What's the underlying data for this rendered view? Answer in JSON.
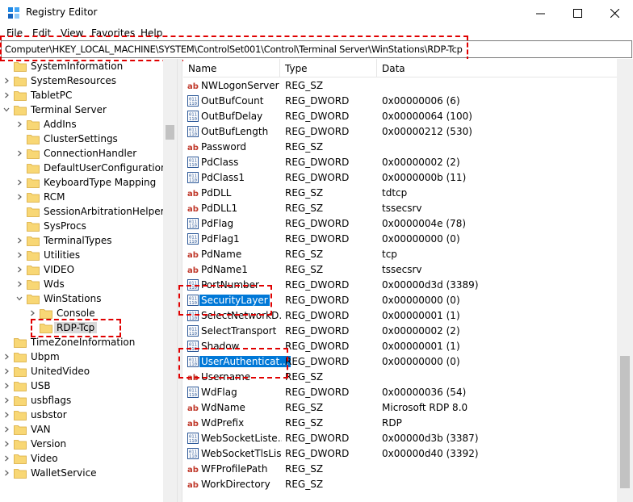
{
  "window": {
    "title": "Registry Editor",
    "minimize": "—",
    "maximize": "☐",
    "close": "✕"
  },
  "menu": [
    "File",
    "Edit",
    "View",
    "Favorites",
    "Help"
  ],
  "address": "Computer\\HKEY_LOCAL_MACHINE\\SYSTEM\\ControlSet001\\Control\\Terminal Server\\WinStations\\RDP-Tcp",
  "tree": [
    {
      "label": "SystemInformation",
      "level": 1,
      "expander": "none"
    },
    {
      "label": "SystemResources",
      "level": 1,
      "expander": "collapsed"
    },
    {
      "label": "TabletPC",
      "level": 1,
      "expander": "collapsed"
    },
    {
      "label": "Terminal Server",
      "level": 1,
      "expander": "expanded"
    },
    {
      "label": "AddIns",
      "level": 2,
      "expander": "collapsed"
    },
    {
      "label": "ClusterSettings",
      "level": 2,
      "expander": "none"
    },
    {
      "label": "ConnectionHandler",
      "level": 2,
      "expander": "collapsed"
    },
    {
      "label": "DefaultUserConfiguration",
      "level": 2,
      "expander": "none"
    },
    {
      "label": "KeyboardType Mapping",
      "level": 2,
      "expander": "collapsed"
    },
    {
      "label": "RCM",
      "level": 2,
      "expander": "collapsed"
    },
    {
      "label": "SessionArbitrationHelper",
      "level": 2,
      "expander": "none"
    },
    {
      "label": "SysProcs",
      "level": 2,
      "expander": "none"
    },
    {
      "label": "TerminalTypes",
      "level": 2,
      "expander": "collapsed"
    },
    {
      "label": "Utilities",
      "level": 2,
      "expander": "collapsed"
    },
    {
      "label": "VIDEO",
      "level": 2,
      "expander": "collapsed"
    },
    {
      "label": "Wds",
      "level": 2,
      "expander": "collapsed"
    },
    {
      "label": "WinStations",
      "level": 2,
      "expander": "expanded"
    },
    {
      "label": "Console",
      "level": 3,
      "expander": "collapsed"
    },
    {
      "label": "RDP-Tcp",
      "level": 3,
      "expander": "none",
      "selected": true
    },
    {
      "label": "TimeZoneInformation",
      "level": 1,
      "expander": "none"
    },
    {
      "label": "Ubpm",
      "level": 1,
      "expander": "collapsed"
    },
    {
      "label": "UnitedVideo",
      "level": 1,
      "expander": "collapsed"
    },
    {
      "label": "USB",
      "level": 1,
      "expander": "collapsed"
    },
    {
      "label": "usbflags",
      "level": 1,
      "expander": "collapsed"
    },
    {
      "label": "usbstor",
      "level": 1,
      "expander": "collapsed"
    },
    {
      "label": "VAN",
      "level": 1,
      "expander": "collapsed"
    },
    {
      "label": "Version",
      "level": 1,
      "expander": "collapsed"
    },
    {
      "label": "Video",
      "level": 1,
      "expander": "collapsed"
    },
    {
      "label": "WalletService",
      "level": 1,
      "expander": "collapsed"
    }
  ],
  "columns": {
    "name": "Name",
    "type": "Type",
    "data": "Data"
  },
  "values": [
    {
      "name": "NWLogonServer",
      "type": "REG_SZ",
      "data": "",
      "icon": "string"
    },
    {
      "name": "OutBufCount",
      "type": "REG_DWORD",
      "data": "0x00000006 (6)",
      "icon": "binary"
    },
    {
      "name": "OutBufDelay",
      "type": "REG_DWORD",
      "data": "0x00000064 (100)",
      "icon": "binary"
    },
    {
      "name": "OutBufLength",
      "type": "REG_DWORD",
      "data": "0x00000212 (530)",
      "icon": "binary"
    },
    {
      "name": "Password",
      "type": "REG_SZ",
      "data": "",
      "icon": "string"
    },
    {
      "name": "PdClass",
      "type": "REG_DWORD",
      "data": "0x00000002 (2)",
      "icon": "binary"
    },
    {
      "name": "PdClass1",
      "type": "REG_DWORD",
      "data": "0x0000000b (11)",
      "icon": "binary"
    },
    {
      "name": "PdDLL",
      "type": "REG_SZ",
      "data": "tdtcp",
      "icon": "string"
    },
    {
      "name": "PdDLL1",
      "type": "REG_SZ",
      "data": "tssecsrv",
      "icon": "string"
    },
    {
      "name": "PdFlag",
      "type": "REG_DWORD",
      "data": "0x0000004e (78)",
      "icon": "binary"
    },
    {
      "name": "PdFlag1",
      "type": "REG_DWORD",
      "data": "0x00000000 (0)",
      "icon": "binary"
    },
    {
      "name": "PdName",
      "type": "REG_SZ",
      "data": "tcp",
      "icon": "string"
    },
    {
      "name": "PdName1",
      "type": "REG_SZ",
      "data": "tssecsrv",
      "icon": "string"
    },
    {
      "name": "PortNumber",
      "type": "REG_DWORD",
      "data": "0x00000d3d (3389)",
      "icon": "binary"
    },
    {
      "name": "SecurityLayer",
      "type": "REG_DWORD",
      "data": "0x00000000 (0)",
      "icon": "binary",
      "selected": true
    },
    {
      "name": "SelectNetworkD...",
      "type": "REG_DWORD",
      "data": "0x00000001 (1)",
      "icon": "binary"
    },
    {
      "name": "SelectTransport",
      "type": "REG_DWORD",
      "data": "0x00000002 (2)",
      "icon": "binary"
    },
    {
      "name": "Shadow",
      "type": "REG_DWORD",
      "data": "0x00000001 (1)",
      "icon": "binary"
    },
    {
      "name": "UserAuthenticat...",
      "type": "REG_DWORD",
      "data": "0x00000000 (0)",
      "icon": "binary",
      "selected": true
    },
    {
      "name": "Username",
      "type": "REG_SZ",
      "data": "",
      "icon": "string"
    },
    {
      "name": "WdFlag",
      "type": "REG_DWORD",
      "data": "0x00000036 (54)",
      "icon": "binary"
    },
    {
      "name": "WdName",
      "type": "REG_SZ",
      "data": "Microsoft RDP 8.0",
      "icon": "string"
    },
    {
      "name": "WdPrefix",
      "type": "REG_SZ",
      "data": "RDP",
      "icon": "string"
    },
    {
      "name": "WebSocketListe...",
      "type": "REG_DWORD",
      "data": "0x00000d3b (3387)",
      "icon": "binary"
    },
    {
      "name": "WebSocketTlsLis...",
      "type": "REG_DWORD",
      "data": "0x00000d40 (3392)",
      "icon": "binary"
    },
    {
      "name": "WFProfilePath",
      "type": "REG_SZ",
      "data": "",
      "icon": "string"
    },
    {
      "name": "WorkDirectory",
      "type": "REG_SZ",
      "data": "",
      "icon": "string"
    }
  ],
  "colors": {
    "selection": "#0078d7",
    "highlight": "#e00000",
    "folder": "#f8d775",
    "folder_edge": "#d8a93a",
    "ab_icon": "#c0392b",
    "binary_icon": "#2b5797"
  }
}
